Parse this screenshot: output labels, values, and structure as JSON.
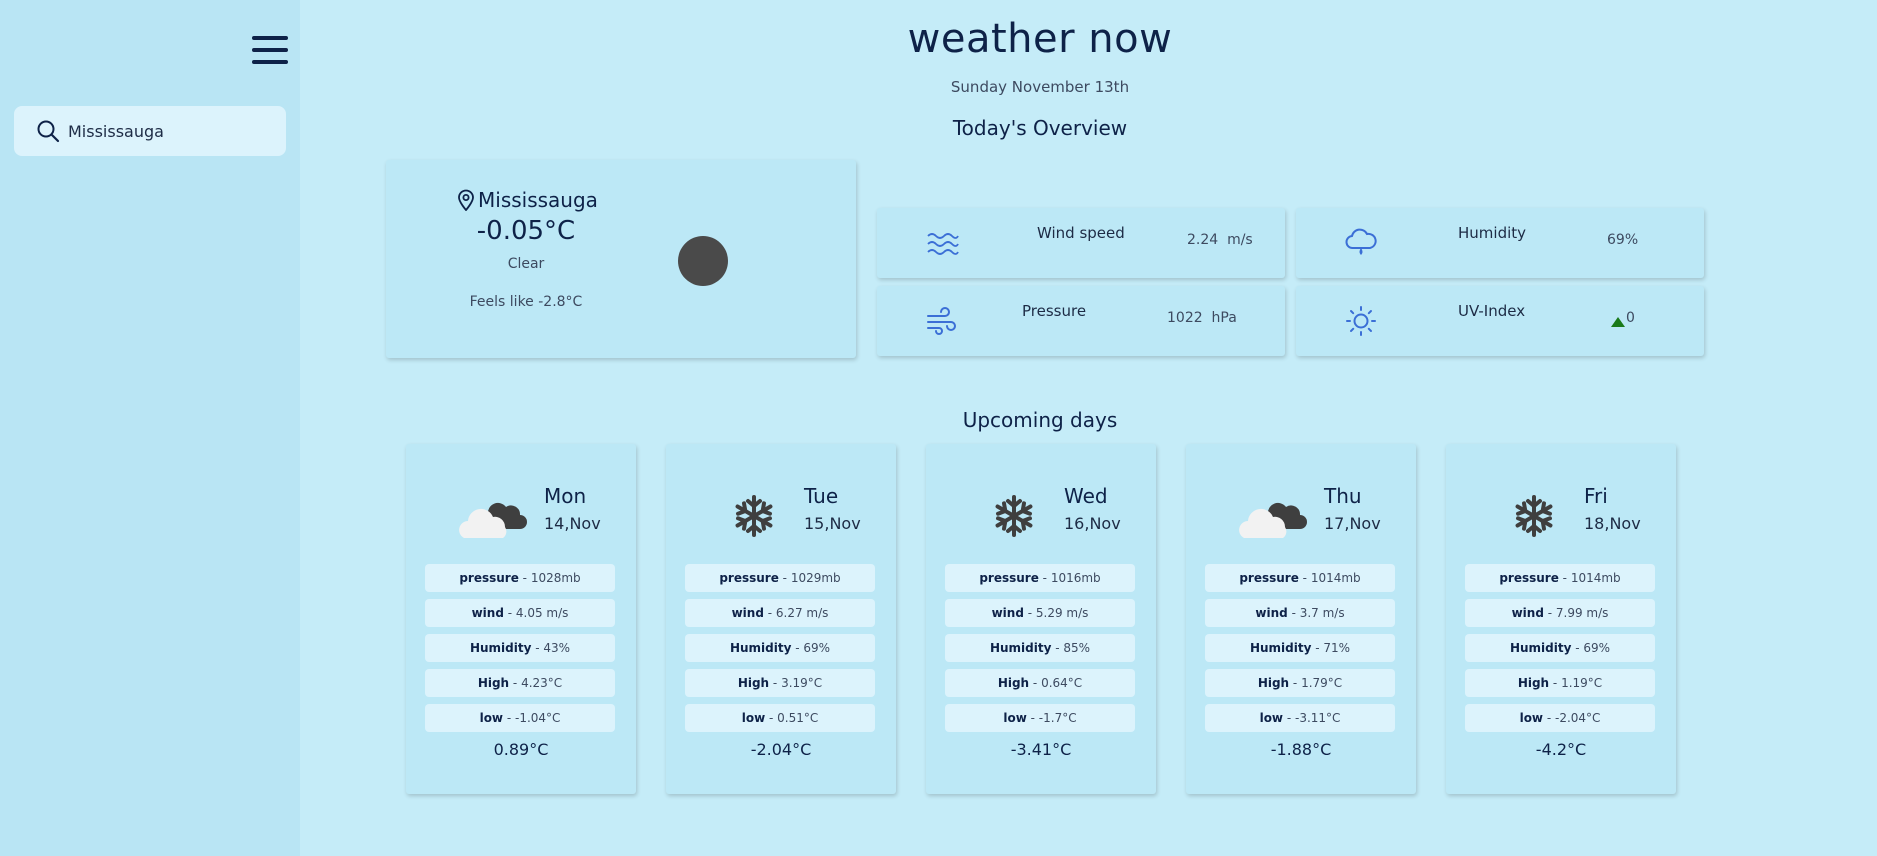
{
  "sidebar": {
    "menu_icon": "hamburger-menu-icon",
    "search": {
      "value": "Mississauga",
      "icon": "search-icon"
    }
  },
  "header": {
    "title": "weather now",
    "date": "Sunday November 13th"
  },
  "overview": {
    "title": "Today's Overview",
    "current": {
      "location": "Mississauga",
      "temperature": "-0.05°C",
      "condition": "Clear",
      "feels_like": "Feels like -2.8°C",
      "condition_color": "#4a4a4a"
    },
    "metrics": [
      {
        "label": "Wind speed",
        "value": "2.24  m/s",
        "icon": "wind-waves-icon"
      },
      {
        "label": "Humidity",
        "value": "69%",
        "icon": "rain-cloud-icon"
      },
      {
        "label": "Pressure",
        "value": "1022  hPa",
        "icon": "wind-gust-icon"
      },
      {
        "label": "UV-Index",
        "value": "0",
        "icon": "sun-icon",
        "trend_icon": "arrow-up-icon",
        "trend_color": "#1a7a1a"
      }
    ]
  },
  "upcoming": {
    "title": "Upcoming days",
    "days": [
      {
        "day": "Mon",
        "date": "14,Nov",
        "icon": "cloudy-icon",
        "pressure": " - 1028mb",
        "wind": " - 4.05 m/s",
        "humidity": " - 43%",
        "high": " - 4.23°C",
        "low": " - -1.04°C",
        "temp": "0.89°C"
      },
      {
        "day": "Tue",
        "date": "15,Nov",
        "icon": "snowflake-icon",
        "pressure": " - 1029mb",
        "wind": " - 6.27 m/s",
        "humidity": " - 69%",
        "high": " - 3.19°C",
        "low": " - 0.51°C",
        "temp": "-2.04°C"
      },
      {
        "day": "Wed",
        "date": "16,Nov",
        "icon": "snowflake-icon",
        "pressure": " - 1016mb",
        "wind": " - 5.29 m/s",
        "humidity": " - 85%",
        "high": " - 0.64°C",
        "low": " - -1.7°C",
        "temp": "-3.41°C"
      },
      {
        "day": "Thu",
        "date": "17,Nov",
        "icon": "cloudy-icon",
        "pressure": " - 1014mb",
        "wind": " - 3.7 m/s",
        "humidity": " - 71%",
        "high": " - 1.79°C",
        "low": " - -3.11°C",
        "temp": "-1.88°C"
      },
      {
        "day": "Fri",
        "date": "18,Nov",
        "icon": "snowflake-icon",
        "pressure": " - 1014mb",
        "wind": " - 7.99 m/s",
        "humidity": " - 69%",
        "high": " - 1.19°C",
        "low": " - -2.04°C",
        "temp": "-4.2°C"
      }
    ],
    "labels": {
      "pressure": "pressure",
      "wind": "wind",
      "humidity": "Humidity",
      "high": "High",
      "low": "low"
    }
  },
  "colors": {
    "background": "#c5ecf8",
    "sidebar": "#b9e5f4",
    "card": "#bce8f6",
    "pill": "#dcf3fc",
    "accent_icon": "#3b6fd6",
    "text": "#0e2248"
  }
}
